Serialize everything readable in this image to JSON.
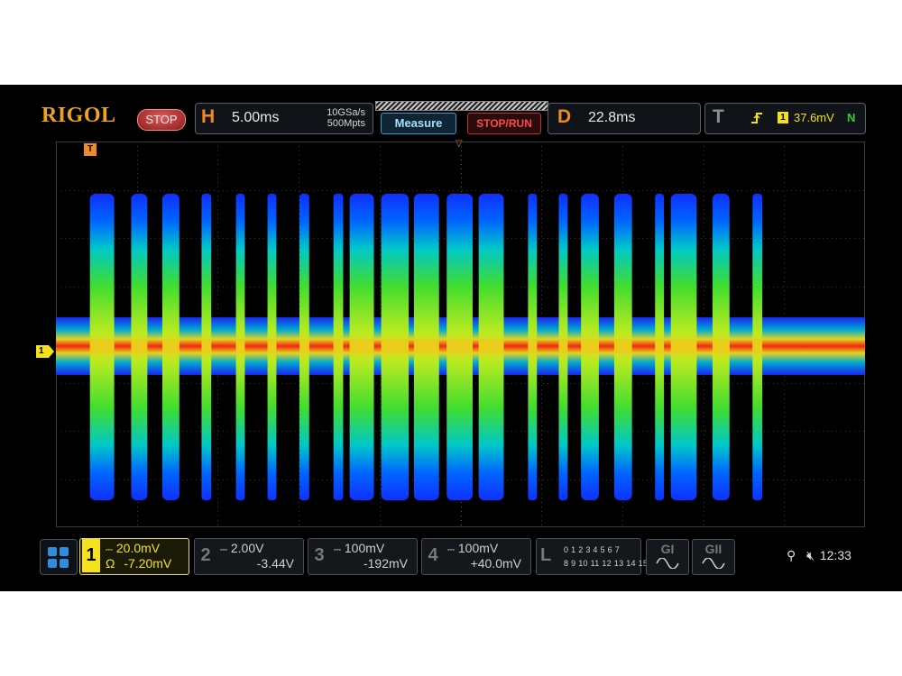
{
  "brand": "RIGOL",
  "run_state": "STOP",
  "horizontal": {
    "letter": "H",
    "timebase": "5.00ms",
    "sample_rate": "10GSa/s",
    "memory_depth": "500Mpts"
  },
  "buttons": {
    "measure": "Measure",
    "stop_run": "STOP/RUN"
  },
  "delay": {
    "letter": "D",
    "value": "22.8ms"
  },
  "trigger": {
    "letter": "T",
    "source": "1",
    "level": "37.6mV",
    "mode": "N"
  },
  "channels": [
    {
      "num": "1",
      "scale": "20.0mV",
      "coupling": "Ω",
      "offset": "-7.20mV",
      "active": true,
      "color": "#f5e21a"
    },
    {
      "num": "2",
      "scale": "2.00V",
      "offset": "-3.44V",
      "active": false
    },
    {
      "num": "3",
      "scale": "100mV",
      "offset": "-192mV",
      "active": false
    },
    {
      "num": "4",
      "scale": "100mV",
      "offset": "+40.0mV",
      "active": false
    }
  ],
  "logic": {
    "letter": "L",
    "row1": "0 1 2 3   4 5 6 7",
    "row2": "8 9 10 11 12 13 14 15"
  },
  "generators": [
    {
      "label": "GI"
    },
    {
      "label": "GII"
    }
  ],
  "status": {
    "time": "12:33"
  },
  "markers": {
    "trigger_pos": "T",
    "channel1": "1"
  },
  "colors": {
    "accent_orange": "#f08a22",
    "channel1": "#f5e21a",
    "stop_red": "#c03030",
    "measure_blue": "#3a9bd0"
  },
  "icons": [
    "grid-menu-icon",
    "usb-icon",
    "speaker-mute-icon",
    "sine-wave-icon",
    "trigger-edge-icon"
  ],
  "waveform": {
    "description_type": "persistence-rf-bursts",
    "bursts": [
      {
        "center": 0.057,
        "width": 0.03
      },
      {
        "center": 0.103,
        "width": 0.02
      },
      {
        "center": 0.142,
        "width": 0.021
      },
      {
        "center": 0.186,
        "width": 0.012
      },
      {
        "center": 0.228,
        "width": 0.011
      },
      {
        "center": 0.267,
        "width": 0.011
      },
      {
        "center": 0.307,
        "width": 0.012
      },
      {
        "center": 0.349,
        "width": 0.012
      },
      {
        "center": 0.378,
        "width": 0.03
      },
      {
        "center": 0.419,
        "width": 0.034
      },
      {
        "center": 0.458,
        "width": 0.031
      },
      {
        "center": 0.499,
        "width": 0.032
      },
      {
        "center": 0.538,
        "width": 0.031
      },
      {
        "center": 0.589,
        "width": 0.011
      },
      {
        "center": 0.627,
        "width": 0.011
      },
      {
        "center": 0.66,
        "width": 0.022
      },
      {
        "center": 0.701,
        "width": 0.022
      },
      {
        "center": 0.746,
        "width": 0.011
      },
      {
        "center": 0.776,
        "width": 0.032
      },
      {
        "center": 0.822,
        "width": 0.021
      },
      {
        "center": 0.867,
        "width": 0.012
      }
    ]
  }
}
